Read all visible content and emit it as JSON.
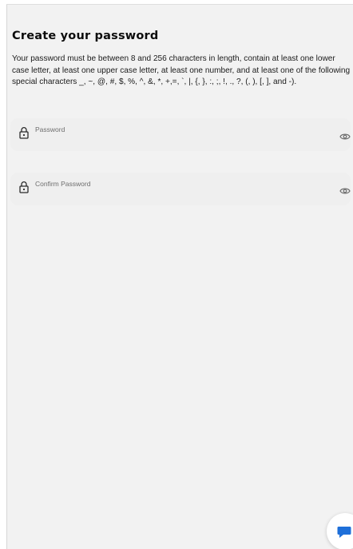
{
  "page": {
    "title": "Create your password",
    "description": "Your password must be between 8 and 256 characters in length, contain at least one lower case letter, at least one upper case letter, at least one number, and at least one of the following special characters _, ~, @, #, $, %, ^, &, *, +,=, `, |, {, }, :, ;, !, ., ?, (, ), [, ], and -)."
  },
  "fields": {
    "password": {
      "label": "Password",
      "icon": "lock-icon",
      "toggle_icon": "eye-icon"
    },
    "confirm_password": {
      "label": "Confirm Password",
      "icon": "lock-icon",
      "toggle_icon": "eye-icon"
    }
  },
  "chat_button": {
    "icon": "chat-bubble-icon"
  },
  "colors": {
    "background": "#f2f2f2",
    "field_background": "#efefef",
    "chat_icon": "#1e6fd9"
  }
}
